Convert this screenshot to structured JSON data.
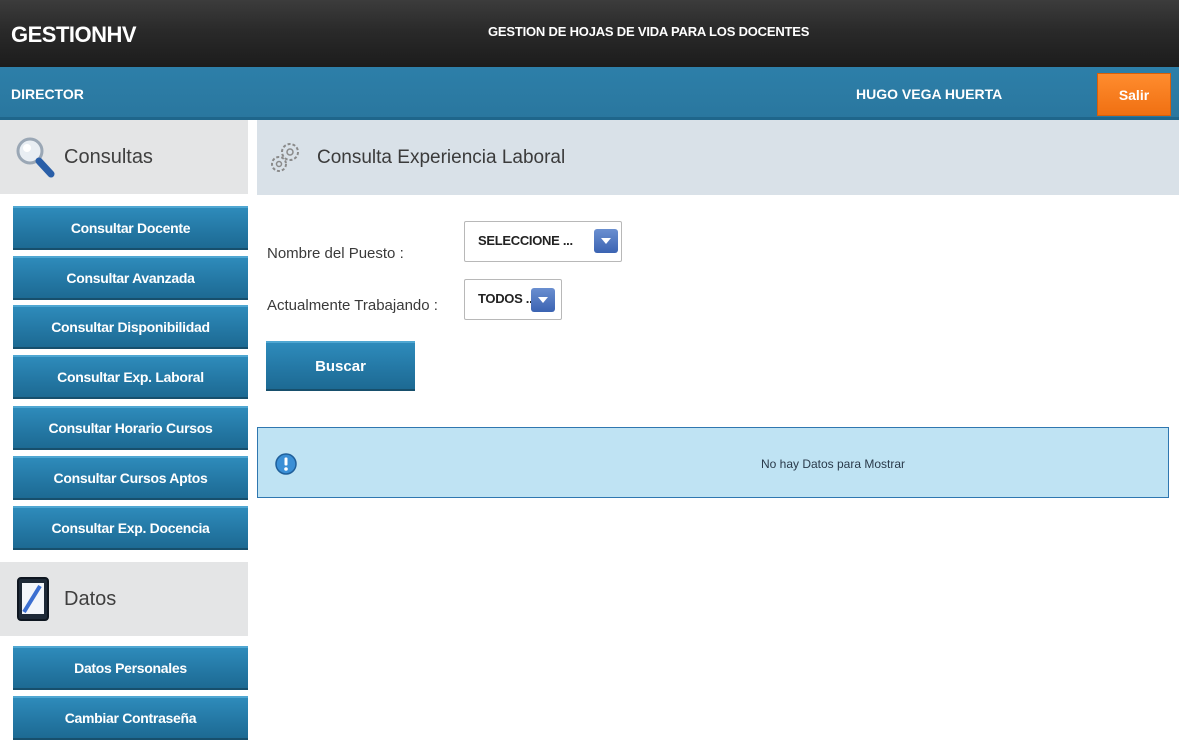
{
  "header": {
    "brand": "GESTIONHV",
    "app_title": "GESTION DE HOJAS DE VIDA PARA LOS DOCENTES"
  },
  "rolebar": {
    "role": "DIRECTOR",
    "user": "HUGO VEGA HUERTA",
    "logout_label": "Salir"
  },
  "sidebar": {
    "sections": [
      {
        "title": "Consultas",
        "icon": "search-icon",
        "items": [
          "Consultar Docente",
          "Consultar Avanzada",
          "Consultar Disponibilidad",
          "Consultar Exp. Laboral",
          "Consultar Horario Cursos",
          "Consultar Cursos Aptos",
          "Consultar Exp. Docencia"
        ]
      },
      {
        "title": "Datos",
        "icon": "tablet-icon",
        "items": [
          "Datos Personales",
          "Cambiar Contraseña"
        ]
      }
    ]
  },
  "main": {
    "title": "Consulta Experiencia Laboral",
    "icon": "gear-icon",
    "form": {
      "puesto_label": "Nombre del Puesto :",
      "puesto_value": "SELECCIONE ...",
      "trabajando_label": "Actualmente Trabajando :",
      "trabajando_value": "TODOS ...",
      "search_label": "Buscar"
    },
    "info_message": "No hay Datos para Mostrar"
  },
  "colors": {
    "header_dark": "#2a2a2a",
    "rolebar_blue": "#2d7fa9",
    "button_blue": "#2478a5",
    "logout_orange": "#f07012",
    "info_bg": "#bfe3f3"
  }
}
